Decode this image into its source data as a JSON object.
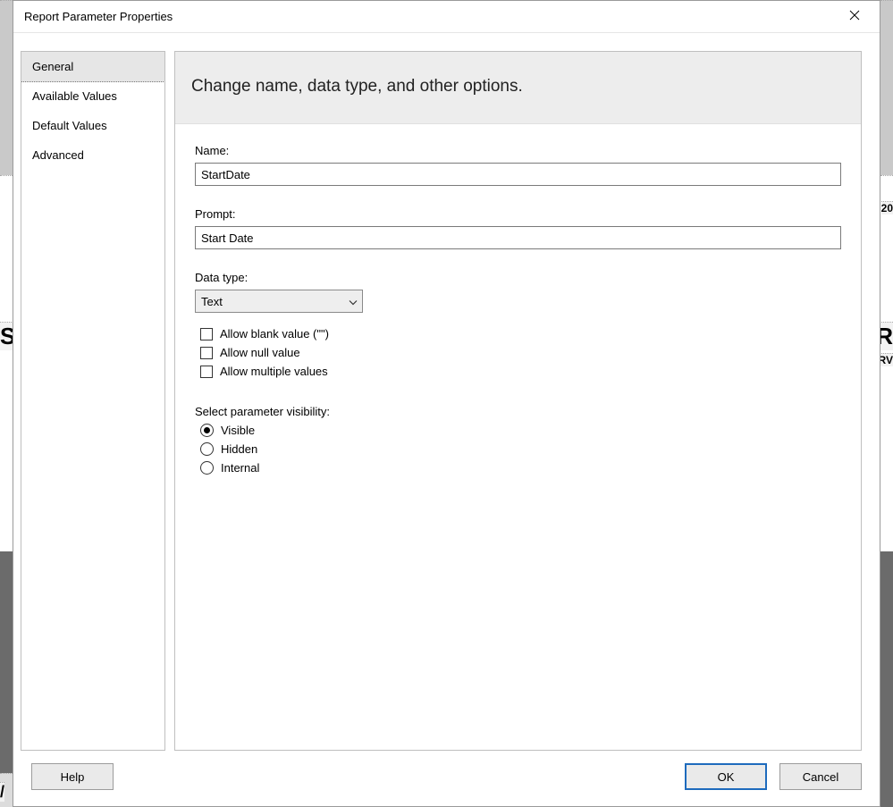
{
  "window": {
    "title": "Report Parameter Properties"
  },
  "sidebar": {
    "items": [
      {
        "label": "General",
        "selected": true
      },
      {
        "label": "Available Values",
        "selected": false
      },
      {
        "label": "Default Values",
        "selected": false
      },
      {
        "label": "Advanced",
        "selected": false
      }
    ]
  },
  "header": {
    "subtitle": "Change name, data type, and other options."
  },
  "form": {
    "name_label": "Name:",
    "name_value": "StartDate",
    "prompt_label": "Prompt:",
    "prompt_value": "Start Date",
    "datatype_label": "Data type:",
    "datatype_value": "Text",
    "checks": {
      "allow_blank": "Allow blank value (\"\")",
      "allow_null": "Allow null value",
      "allow_multiple": "Allow multiple values"
    },
    "visibility_label": "Select parameter visibility:",
    "visibility": {
      "visible": "Visible",
      "hidden": "Hidden",
      "internal": "Internal",
      "selected": "visible"
    }
  },
  "footer": {
    "help": "Help",
    "ok": "OK",
    "cancel": "Cancel"
  },
  "background": {
    "left_s": "S",
    "right_er": "ER",
    "right_20": "20",
    "right_rv": "RV",
    "slash": "/"
  }
}
